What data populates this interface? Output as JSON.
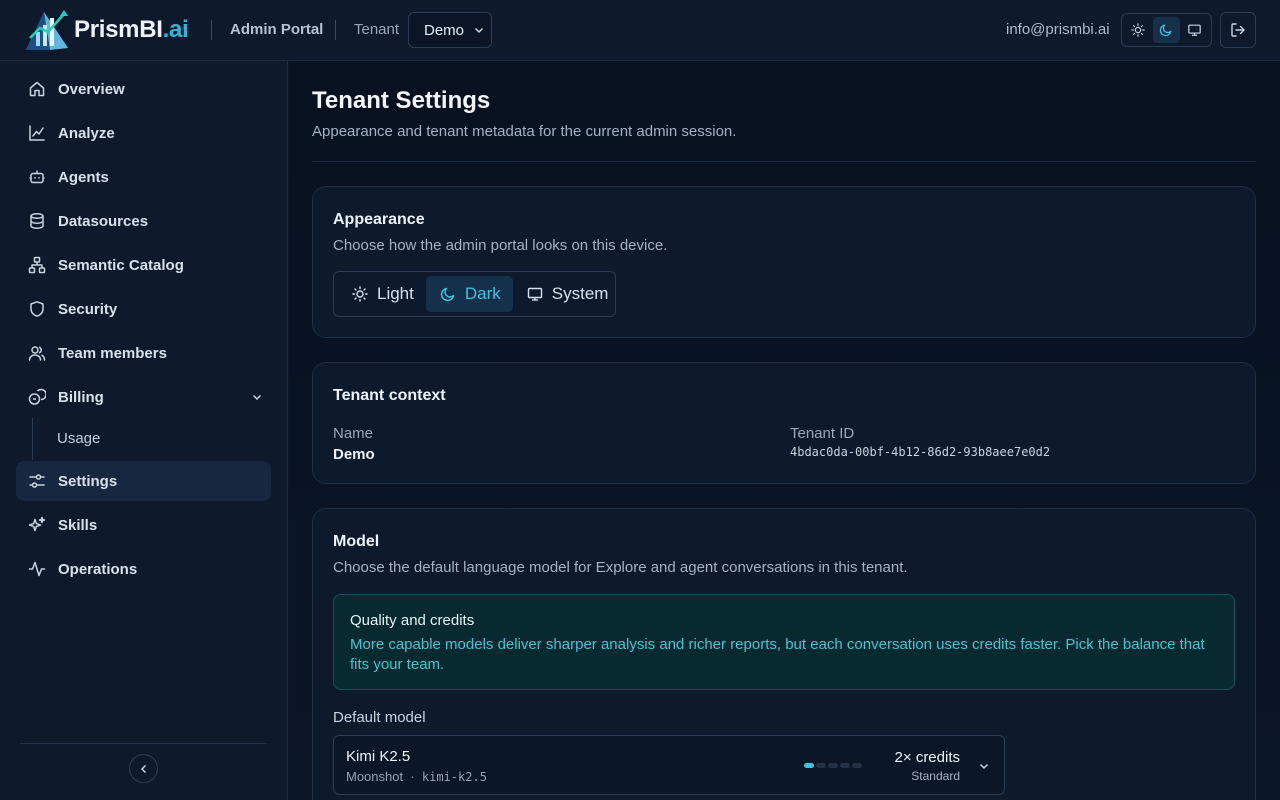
{
  "header": {
    "logo_text": "PrismBI",
    "logo_suffix": ".ai",
    "portal_label": "Admin Portal",
    "tenant_label": "Tenant",
    "tenant_value": "Demo",
    "user_email": "info@prismbi.ai",
    "theme_active": "dark"
  },
  "sidebar": {
    "items": [
      {
        "label": "Overview",
        "icon": "home-icon"
      },
      {
        "label": "Analyze",
        "icon": "line-chart-icon"
      },
      {
        "label": "Agents",
        "icon": "bot-icon"
      },
      {
        "label": "Datasources",
        "icon": "database-icon"
      },
      {
        "label": "Semantic Catalog",
        "icon": "network-icon"
      },
      {
        "label": "Security",
        "icon": "shield-icon"
      },
      {
        "label": "Team members",
        "icon": "users-icon"
      },
      {
        "label": "Billing",
        "icon": "coins-icon"
      },
      {
        "label": "Settings",
        "icon": "sliders-icon"
      },
      {
        "label": "Skills",
        "icon": "sparkles-icon"
      },
      {
        "label": "Operations",
        "icon": "activity-icon"
      }
    ],
    "billing_sub": "Usage",
    "active": "Settings"
  },
  "main": {
    "title": "Tenant Settings",
    "subtitle": "Appearance and tenant metadata for the current admin session.",
    "appearance": {
      "title": "Appearance",
      "subtitle": "Choose how the admin portal looks on this device.",
      "options": [
        "Light",
        "Dark",
        "System"
      ],
      "selected": "Dark"
    },
    "tenant_context": {
      "title": "Tenant context",
      "name_label": "Name",
      "name_value": "Demo",
      "id_label": "Tenant ID",
      "id_value": "4bdac0da-00bf-4b12-86d2-93b8aee7e0d2"
    },
    "model": {
      "title": "Model",
      "subtitle": "Choose the default language model for Explore and agent conversations in this tenant.",
      "callout_title": "Quality and credits",
      "callout_body": "More capable models deliver sharper analysis and richer reports, but each conversation uses credits faster. Pick the balance that fits your team.",
      "default_label": "Default model",
      "selected_name": "Kimi K2.5",
      "selected_provider": "Moonshot",
      "selected_separator": "·",
      "selected_id": "kimi-k2.5",
      "credits": "2× credits",
      "tier": "Standard",
      "cost_level": 1,
      "cost_max": 5
    }
  },
  "colors": {
    "accent": "#3fc3e0",
    "background": "#0b1525",
    "panel": "#0d1a2c"
  }
}
